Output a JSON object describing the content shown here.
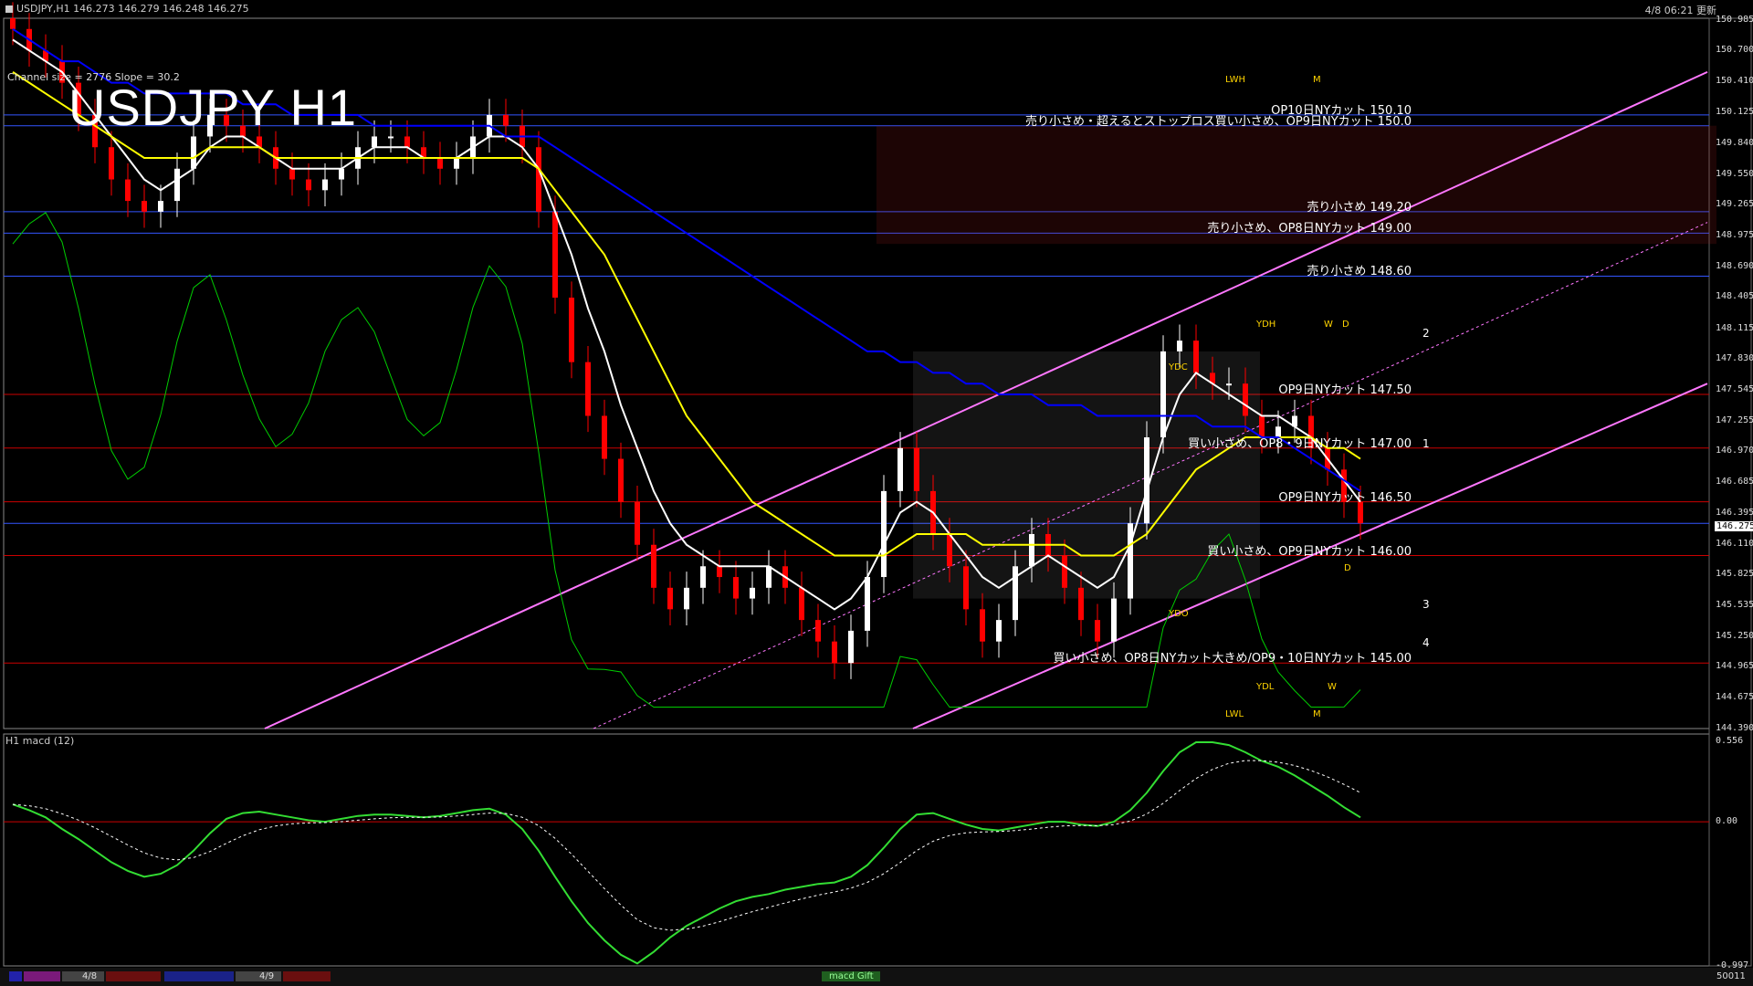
{
  "window": {
    "title": "USDJPY,H1  146.273 146.279 146.248 146.275",
    "timestamp": "4/8 06:21 更新"
  },
  "overlay": {
    "big_title": "USDJPY H1",
    "channel_info": "Channel size = 2776 Slope = 30.2",
    "macd_label": "H1  macd (12)"
  },
  "price_axis": {
    "ticks": [
      "150.985",
      "150.700",
      "150.410",
      "150.125",
      "149.840",
      "149.550",
      "149.265",
      "148.975",
      "148.690",
      "148.405",
      "148.115",
      "147.830",
      "147.545",
      "147.255",
      "146.970",
      "146.685",
      "146.395",
      "146.110",
      "145.825",
      "145.535",
      "145.250",
      "144.965",
      "144.675",
      "144.390"
    ],
    "current_price": "146.275",
    "macd_ticks": [
      "0.556",
      "0.00",
      "-0.997"
    ],
    "bottom_right": "50011"
  },
  "annotations": [
    {
      "text": "OP10日NYカット 150.10",
      "price": 150.1
    },
    {
      "text": "売り小さめ・超えるとストップロス買い小さめ、OP9日NYカット 150.0",
      "price": 150.0
    },
    {
      "text": "売り小さめ 149.20",
      "price": 149.2
    },
    {
      "text": "売り小さめ、OP8日NYカット 149.00",
      "price": 149.0
    },
    {
      "text": "売り小さめ 148.60",
      "price": 148.6
    },
    {
      "text": "OP9日NYカット 147.50",
      "price": 147.5
    },
    {
      "text": "買い小さめ、OP8・9日NYカット 147.00",
      "price": 147.0
    },
    {
      "text": "OP9日NYカット 146.50",
      "price": 146.5
    },
    {
      "text": "買い小さめ、OP9日NYカット 146.00",
      "price": 146.0
    },
    {
      "text": "買い小さめ、OP8日NYカット大きめ/OP9・10日NYカット 145.00",
      "price": 145.0
    }
  ],
  "level_labels": [
    "LWH",
    "M",
    "YDH",
    "W",
    "D",
    "YDC",
    "YDO",
    "YDL",
    "LWL",
    "W",
    "M",
    "D",
    "1",
    "2",
    "3",
    "4"
  ],
  "date_bar": {
    "labels": [
      "4/8",
      "4/9"
    ],
    "macd_tag": "macd Gift"
  },
  "colors": {
    "bg": "#000000",
    "bull": "#ffffff",
    "bear": "#ff0000",
    "sma_white": "#ffffff",
    "sma_yellow": "#ffff00",
    "sma_blue": "#0000ff",
    "channel": "#ff77ff",
    "green": "#00cc00",
    "grid_blue": "#3355ff",
    "grid_red": "#cc0000",
    "macd_line": "#33dd33",
    "macd_signal": "#ffffff"
  },
  "chart_data": {
    "type": "line",
    "price_range": [
      144.39,
      151.0
    ],
    "series": [
      {
        "values": [
          150.9,
          150.7,
          150.6,
          150.4,
          150.1,
          149.8,
          149.5,
          149.3,
          149.2,
          149.3,
          149.6,
          149.9,
          150.1,
          150.0,
          149.9,
          149.8,
          149.6,
          149.5,
          149.4,
          149.5,
          149.6,
          149.8,
          149.9,
          149.9,
          149.8,
          149.7,
          149.6,
          149.7,
          149.9,
          150.1,
          150.0,
          149.8,
          149.2,
          148.4,
          147.8,
          147.3,
          146.9,
          146.5,
          146.1,
          145.7,
          145.5,
          145.7,
          145.9,
          145.8,
          145.6,
          145.7,
          145.9,
          145.7,
          145.4,
          145.2,
          145.0,
          145.3,
          145.8,
          146.6,
          147.0,
          146.6,
          146.2,
          145.9,
          145.5,
          145.2,
          145.4,
          145.9,
          146.2,
          146.0,
          145.7,
          145.4,
          145.2,
          145.6,
          146.3,
          147.1,
          147.9,
          148.0,
          147.7,
          147.6,
          147.6,
          147.3,
          147.1,
          147.2,
          147.3,
          147.0,
          146.8,
          146.5,
          146.3
        ]
      },
      {
        "values": [
          150.8,
          150.7,
          150.6,
          150.5,
          150.3,
          150.1,
          149.9,
          149.7,
          149.5,
          149.4,
          149.5,
          149.6,
          149.8,
          149.9,
          149.9,
          149.8,
          149.7,
          149.6,
          149.6,
          149.6,
          149.6,
          149.7,
          149.8,
          149.8,
          149.8,
          149.7,
          149.7,
          149.7,
          149.8,
          149.9,
          149.9,
          149.8,
          149.6,
          149.2,
          148.8,
          148.3,
          147.9,
          147.4,
          147.0,
          146.6,
          146.3,
          146.1,
          146.0,
          145.9,
          145.9,
          145.9,
          145.9,
          145.8,
          145.7,
          145.6,
          145.5,
          145.6,
          145.8,
          146.1,
          146.4,
          146.5,
          146.4,
          146.2,
          146.0,
          145.8,
          145.7,
          145.8,
          145.9,
          146.0,
          145.9,
          145.8,
          145.7,
          145.8,
          146.1,
          146.6,
          147.1,
          147.5,
          147.7,
          147.6,
          147.5,
          147.4,
          147.3,
          147.3,
          147.2,
          147.1,
          146.9,
          146.7,
          146.5
        ]
      },
      {
        "values": [
          150.5,
          150.4,
          150.3,
          150.2,
          150.1,
          150.0,
          149.9,
          149.8,
          149.7,
          149.7,
          149.7,
          149.7,
          149.8,
          149.8,
          149.8,
          149.8,
          149.7,
          149.7,
          149.7,
          149.7,
          149.7,
          149.7,
          149.7,
          149.7,
          149.7,
          149.7,
          149.7,
          149.7,
          149.7,
          149.7,
          149.7,
          149.7,
          149.6,
          149.4,
          149.2,
          149.0,
          148.8,
          148.5,
          148.2,
          147.9,
          147.6,
          147.3,
          147.1,
          146.9,
          146.7,
          146.5,
          146.4,
          146.3,
          146.2,
          146.1,
          146.0,
          146.0,
          146.0,
          146.0,
          146.1,
          146.2,
          146.2,
          146.2,
          146.2,
          146.1,
          146.1,
          146.1,
          146.1,
          146.1,
          146.1,
          146.0,
          146.0,
          146.0,
          146.1,
          146.2,
          146.4,
          146.6,
          146.8,
          146.9,
          147.0,
          147.1,
          147.1,
          147.1,
          147.1,
          147.1,
          147.0,
          147.0,
          146.9
        ]
      },
      {
        "values": [
          150.9,
          150.8,
          150.7,
          150.6,
          150.6,
          150.5,
          150.4,
          150.4,
          150.3,
          150.3,
          150.3,
          150.3,
          150.3,
          150.3,
          150.2,
          150.2,
          150.2,
          150.1,
          150.1,
          150.1,
          150.1,
          150.1,
          150.0,
          150.0,
          150.0,
          150.0,
          150.0,
          150.0,
          150.0,
          150.0,
          149.9,
          149.9,
          149.9,
          149.8,
          149.7,
          149.6,
          149.5,
          149.4,
          149.3,
          149.2,
          149.1,
          149.0,
          148.9,
          148.8,
          148.7,
          148.6,
          148.5,
          148.4,
          148.3,
          148.2,
          148.1,
          148.0,
          147.9,
          147.9,
          147.8,
          147.8,
          147.7,
          147.7,
          147.6,
          147.6,
          147.5,
          147.5,
          147.5,
          147.4,
          147.4,
          147.4,
          147.3,
          147.3,
          147.3,
          147.3,
          147.3,
          147.3,
          147.3,
          147.2,
          147.2,
          147.2,
          147.1,
          147.1,
          147.0,
          146.9,
          146.8,
          146.7,
          146.6
        ]
      }
    ],
    "macd": [
      0.12,
      0.08,
      0.03,
      -0.05,
      -0.12,
      -0.2,
      -0.28,
      -0.34,
      -0.38,
      -0.36,
      -0.3,
      -0.2,
      -0.08,
      0.02,
      0.06,
      0.07,
      0.05,
      0.03,
      0.01,
      0.0,
      0.02,
      0.04,
      0.05,
      0.05,
      0.04,
      0.03,
      0.04,
      0.06,
      0.08,
      0.09,
      0.05,
      -0.05,
      -0.2,
      -0.38,
      -0.55,
      -0.7,
      -0.82,
      -0.92,
      -0.98,
      -0.9,
      -0.8,
      -0.72,
      -0.66,
      -0.6,
      -0.55,
      -0.52,
      -0.5,
      -0.47,
      -0.45,
      -0.43,
      -0.42,
      -0.38,
      -0.3,
      -0.18,
      -0.05,
      0.05,
      0.06,
      0.02,
      -0.02,
      -0.05,
      -0.06,
      -0.04,
      -0.02,
      0.0,
      0.0,
      -0.02,
      -0.03,
      0.0,
      0.08,
      0.2,
      0.35,
      0.48,
      0.55,
      0.55,
      0.53,
      0.48,
      0.42,
      0.38,
      0.32,
      0.25,
      0.18,
      0.1,
      0.03
    ]
  }
}
